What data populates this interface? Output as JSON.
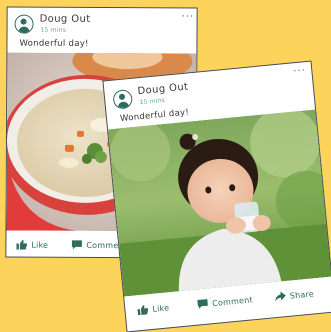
{
  "posts": [
    {
      "author": "Doug Out",
      "time": "15 mins",
      "caption": "Wonderful day!",
      "actions": {
        "like": "Like",
        "comment": "Comment"
      }
    },
    {
      "author": "Doug Out",
      "time": "15 mins",
      "caption": "Wonderful day!",
      "actions": {
        "like": "Like",
        "comment": "Comment",
        "share": "Share"
      }
    }
  ],
  "colors": {
    "background": "#FCD35B",
    "accent": "#2F6B5E",
    "time": "#6AA79A"
  },
  "icons": [
    "user-avatar-icon",
    "more-dots-icon",
    "thumbs-up-icon",
    "comment-icon",
    "share-arrow-icon"
  ]
}
